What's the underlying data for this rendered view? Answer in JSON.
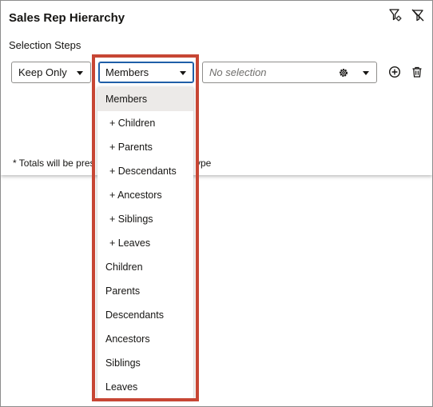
{
  "header": {
    "title": "Sales Rep Hierarchy",
    "icons": [
      "filter-settings-icon",
      "clear-filter-icon"
    ]
  },
  "selection": {
    "label": "Selection Steps",
    "action_select": {
      "value": "Keep Only"
    },
    "type_select": {
      "value": "Members"
    },
    "value_select": {
      "placeholder": "No selection"
    },
    "row_icons": [
      "gear-icon",
      "add-circle-icon",
      "trash-icon"
    ]
  },
  "note": {
    "before": "* Totals will be pres",
    "after": "ype"
  },
  "dropdown": {
    "selected_index": 0,
    "items": [
      {
        "label": "Members"
      },
      {
        "label": "+ Children"
      },
      {
        "label": "+ Parents"
      },
      {
        "label": "+ Descendants"
      },
      {
        "label": "+ Ancestors"
      },
      {
        "label": "+ Siblings"
      },
      {
        "label": "+ Leaves"
      },
      {
        "label": "Children"
      },
      {
        "label": "Parents"
      },
      {
        "label": "Descendants"
      },
      {
        "label": "Ancestors"
      },
      {
        "label": "Siblings"
      },
      {
        "label": "Leaves"
      }
    ]
  },
  "colors": {
    "highlight": "#c74634",
    "focus": "#1f5fa8",
    "selected_bg": "#eceae8"
  }
}
